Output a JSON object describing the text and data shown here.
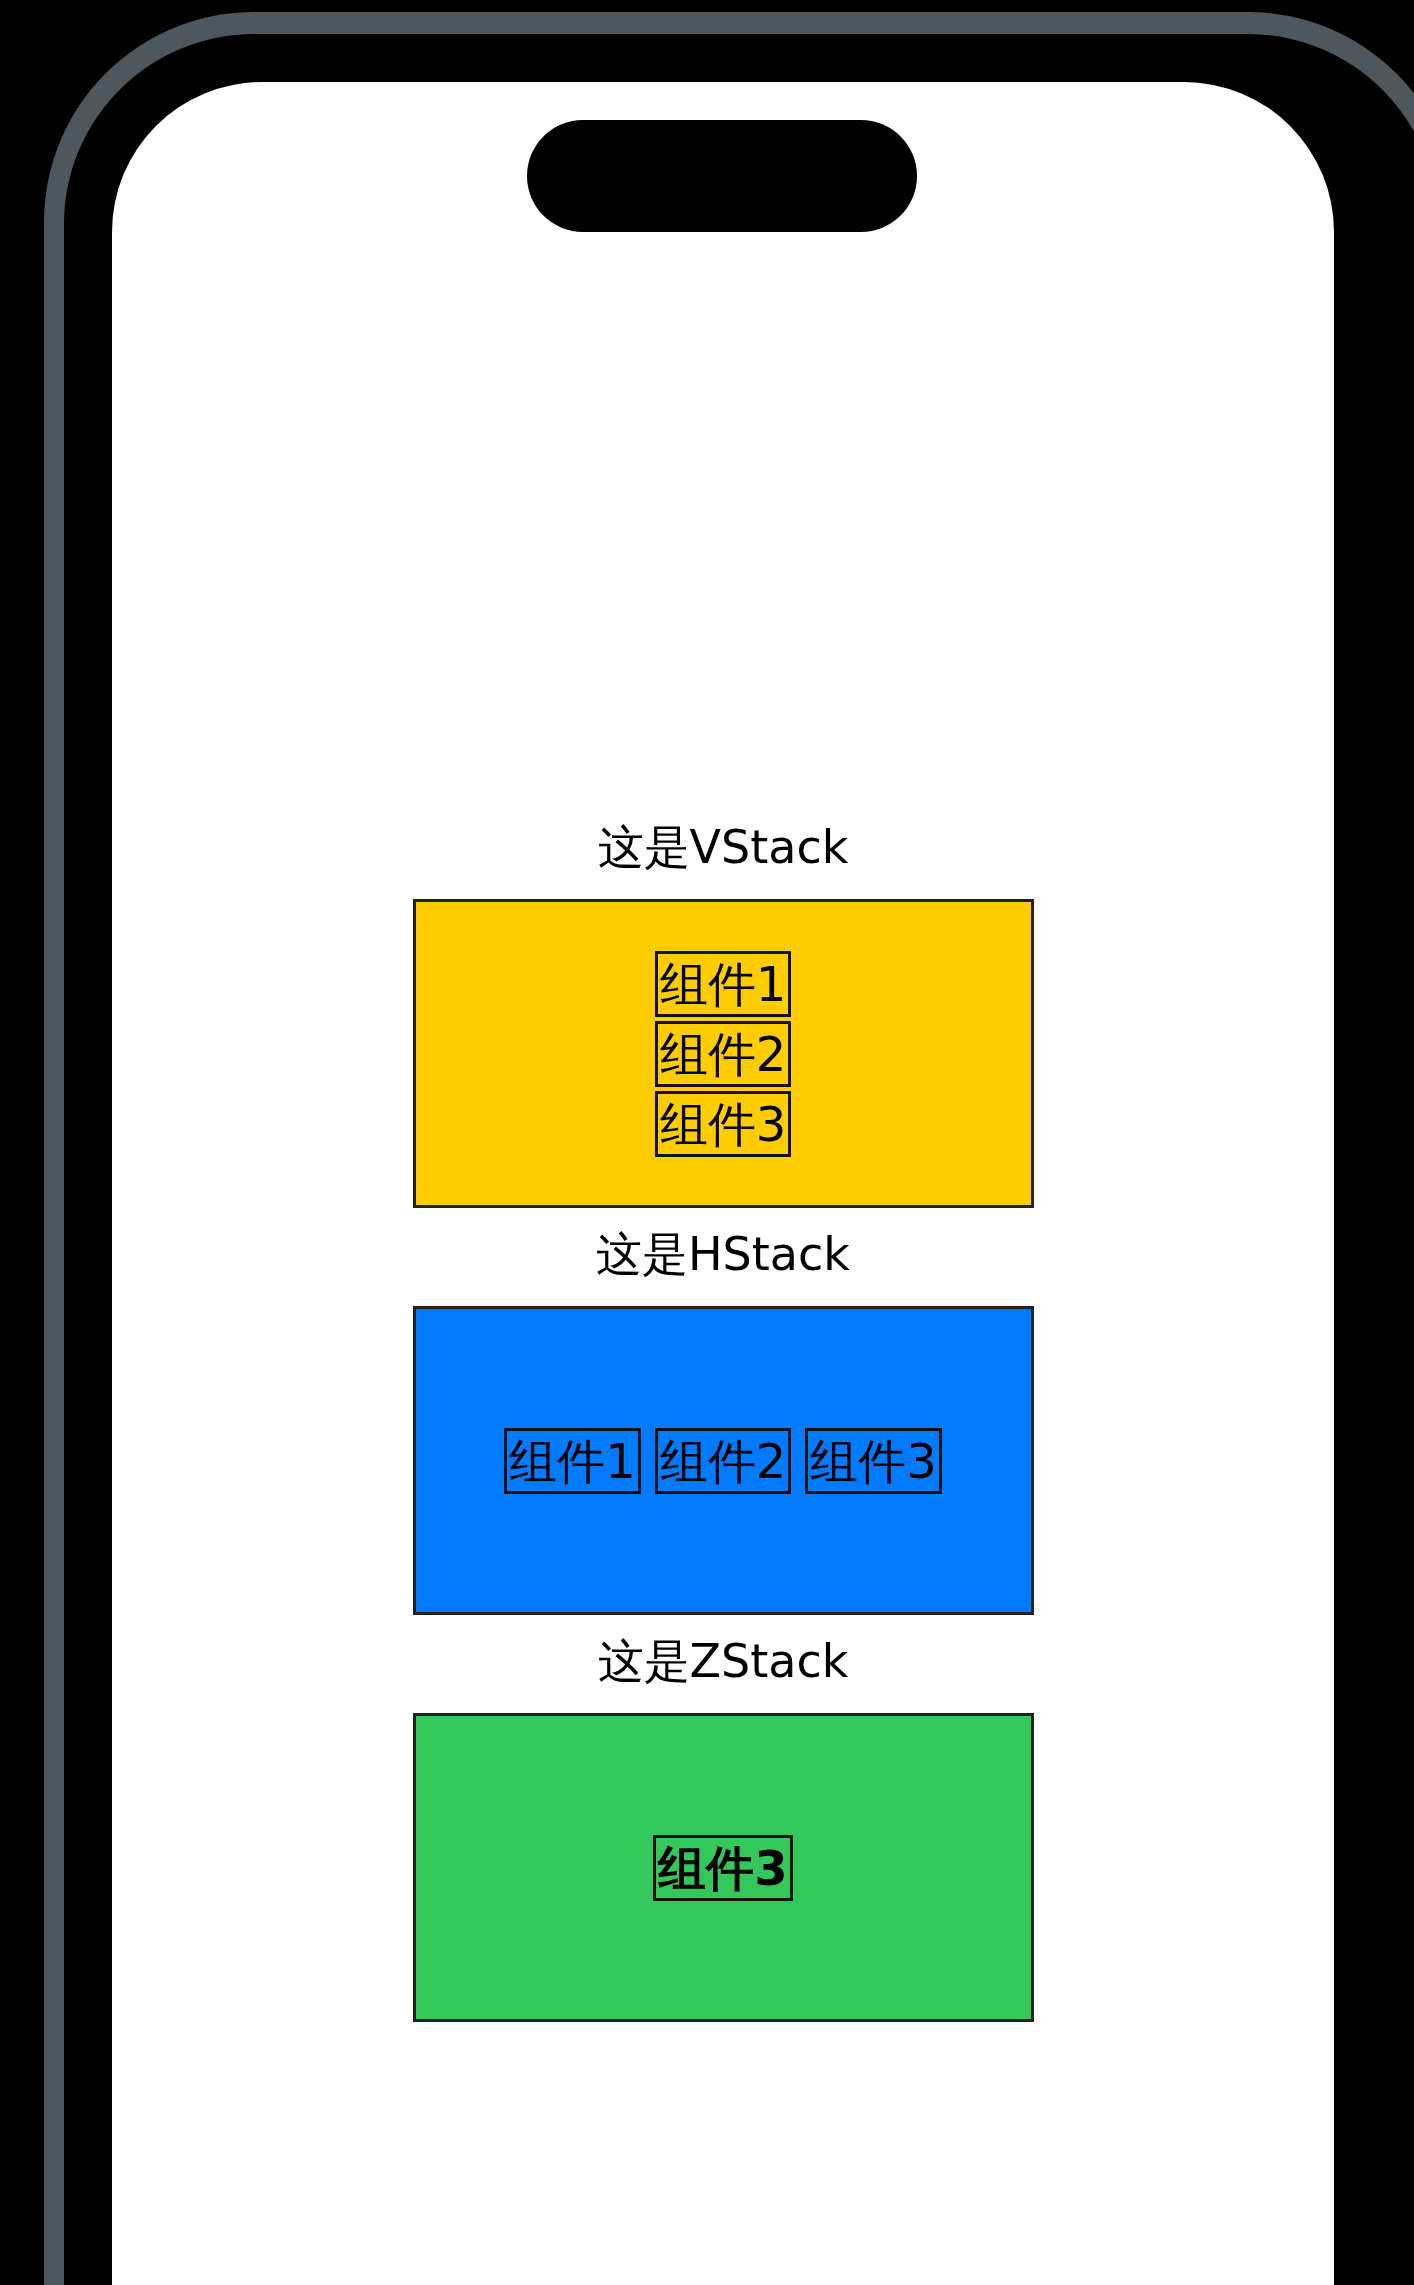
{
  "sections": [
    {
      "kind": "vstack",
      "title": "这是VStack",
      "color": "#ffcc00",
      "items": [
        "组件1",
        "组件2",
        "组件3"
      ]
    },
    {
      "kind": "hstack",
      "title": "这是HStack",
      "color": "#007aff",
      "items": [
        "组件1",
        "组件2",
        "组件3"
      ]
    },
    {
      "kind": "zstack",
      "title": "这是ZStack",
      "color": "#34c759",
      "items": [
        "组件3"
      ]
    }
  ]
}
